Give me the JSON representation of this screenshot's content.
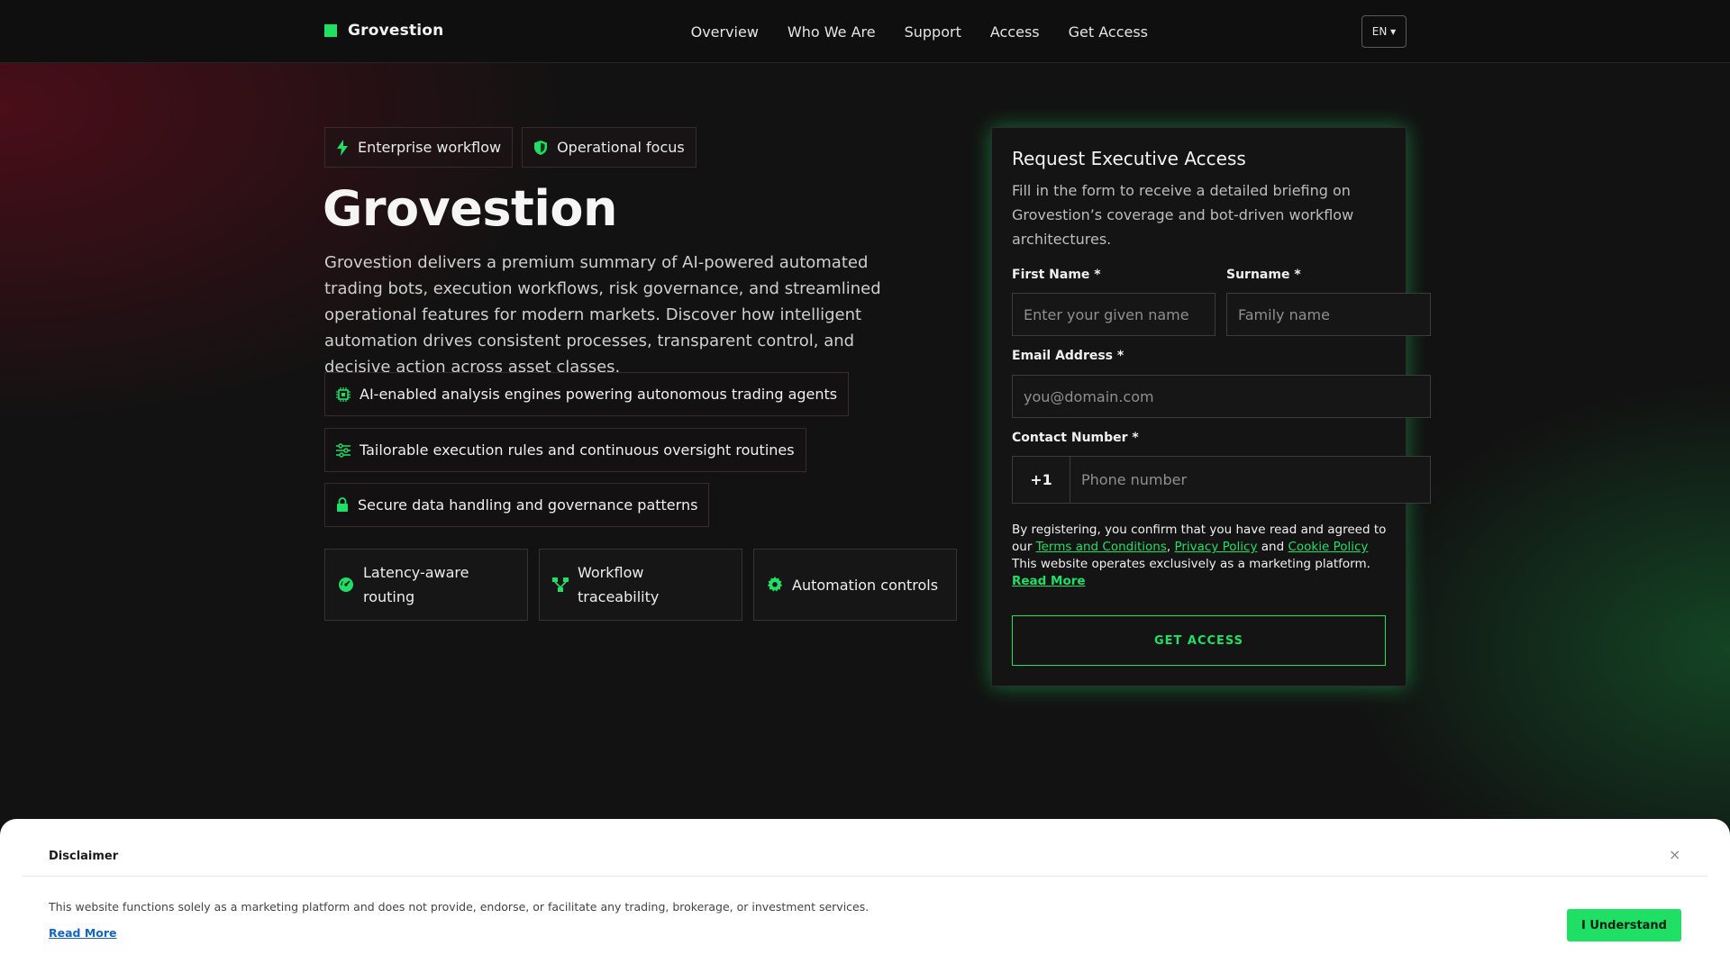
{
  "header": {
    "brand": "Grovestion",
    "nav": [
      "Overview",
      "Who We Are",
      "Support",
      "Access",
      "Get Access"
    ],
    "language": "EN ▾"
  },
  "hero": {
    "badges": [
      "Enterprise workflow",
      "Operational focus"
    ],
    "title": "Grovestion",
    "description": "Grovestion delivers a premium summary of AI-powered automated trading bots, execution workflows, risk governance, and streamlined operational features for modern markets. Discover how intelligent automation drives consistent processes, transparent control, and decisive action across asset classes.",
    "features": [
      "AI-enabled analysis engines powering autonomous trading agents",
      "Tailorable execution rules and continuous oversight routines",
      "Secure data handling and governance patterns"
    ],
    "tiles": [
      "Latency-aware routing",
      "Workflow traceability",
      "Automation controls"
    ]
  },
  "form": {
    "title": "Request Executive Access",
    "subtitle": "Fill in the form to receive a detailed briefing on Grovestion’s coverage and bot-driven workflow architectures.",
    "first_name_label": "First Name *",
    "first_name_placeholder": "Enter your given name",
    "surname_label": "Surname *",
    "surname_placeholder": "Family name",
    "email_label": "Email Address *",
    "email_placeholder": "you@domain.com",
    "phone_label": "Contact Number *",
    "phone_prefix": "+1",
    "phone_placeholder": "Phone number",
    "consent_prefix": "By registering, you confirm that you have read and agreed to our ",
    "terms_link": "Terms and Conditions",
    "comma": ", ",
    "privacy_link": "Privacy Policy",
    "and": " and ",
    "cookie_link": "Cookie Policy",
    "consent_suffix": " This website operates exclusively as a marketing platform. ",
    "read_more": "Read More",
    "submit": "GET ACCESS"
  },
  "disclaimer": {
    "title": "Disclaimer",
    "close": "×",
    "text": "This website functions solely as a marketing platform and does not provide, endorse, or facilitate any trading, brokerage, or investment services.",
    "read_more": "Read More",
    "button": "I Understand"
  },
  "colors": {
    "accent": "#1fe065",
    "background": "#121212",
    "link_blue": "#1565c0"
  },
  "icons": {
    "badges": [
      "bolt-icon",
      "shield-icon"
    ],
    "features": [
      "chip-icon",
      "sliders-icon",
      "lock-icon"
    ],
    "tiles": [
      "gauge-icon",
      "flow-icon",
      "gear-icon"
    ]
  }
}
